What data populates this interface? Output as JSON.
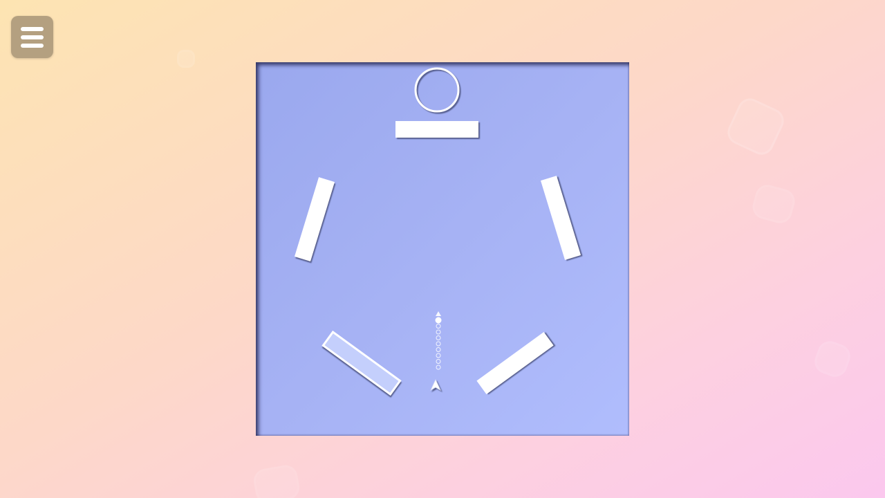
{
  "app": {
    "menu_icon": "hamburger-menu-icon"
  },
  "colors": {
    "background_start": "#fde4b2",
    "background_end": "#fbc8ee",
    "board": "#a6b2f4",
    "menu_button": "#b4a080",
    "block": "#ffffff",
    "target_block": "#c4cffc",
    "shadow": "#5a5f8a"
  },
  "game": {
    "goal": {
      "type": "ring"
    },
    "blocks": [
      {
        "id": "top",
        "kind": "solid"
      },
      {
        "id": "upper-left",
        "kind": "solid"
      },
      {
        "id": "upper-right",
        "kind": "solid"
      },
      {
        "id": "lower-left",
        "kind": "outlined"
      },
      {
        "id": "lower-right",
        "kind": "solid"
      }
    ],
    "launcher": {
      "aim_dots": 9,
      "icon": "arrow-up-icon"
    }
  }
}
